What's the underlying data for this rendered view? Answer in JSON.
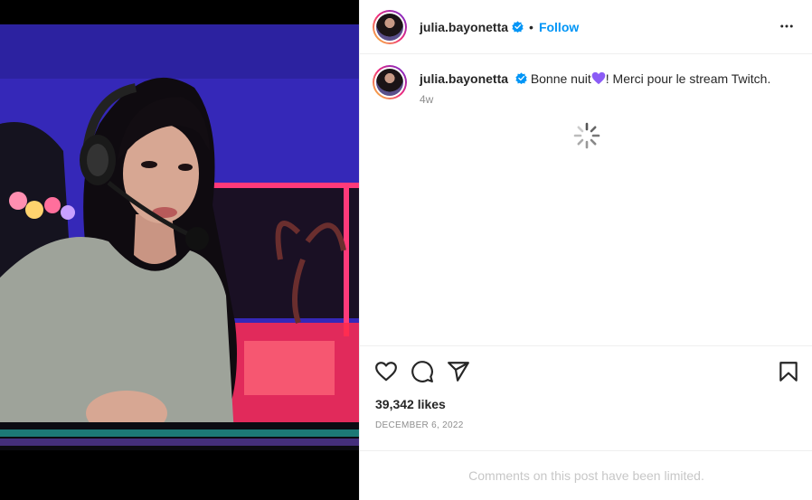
{
  "post": {
    "username": "julia.bayonetta",
    "separator": "•",
    "follow_label": "Follow",
    "caption_before_emoji": "Bonne nuit",
    "caption_after_emoji": "! Merci pour le stream Twitch.",
    "time_ago": "4w",
    "likes": "39,342 likes",
    "date": "DECEMBER 6, 2022",
    "comments_limited": "Comments on this post have been limited."
  },
  "icons": {
    "verified": "verified-badge-icon",
    "more": "more-options-icon",
    "like": "heart-icon",
    "comment": "comment-icon",
    "share": "share-icon",
    "save": "bookmark-icon",
    "loading": "loading-spinner-icon",
    "emoji": "purple-heart-emoji"
  },
  "colors": {
    "accent": "#0095f6",
    "verified": "#0095f6",
    "emoji_heart": "#8b5cf6"
  }
}
